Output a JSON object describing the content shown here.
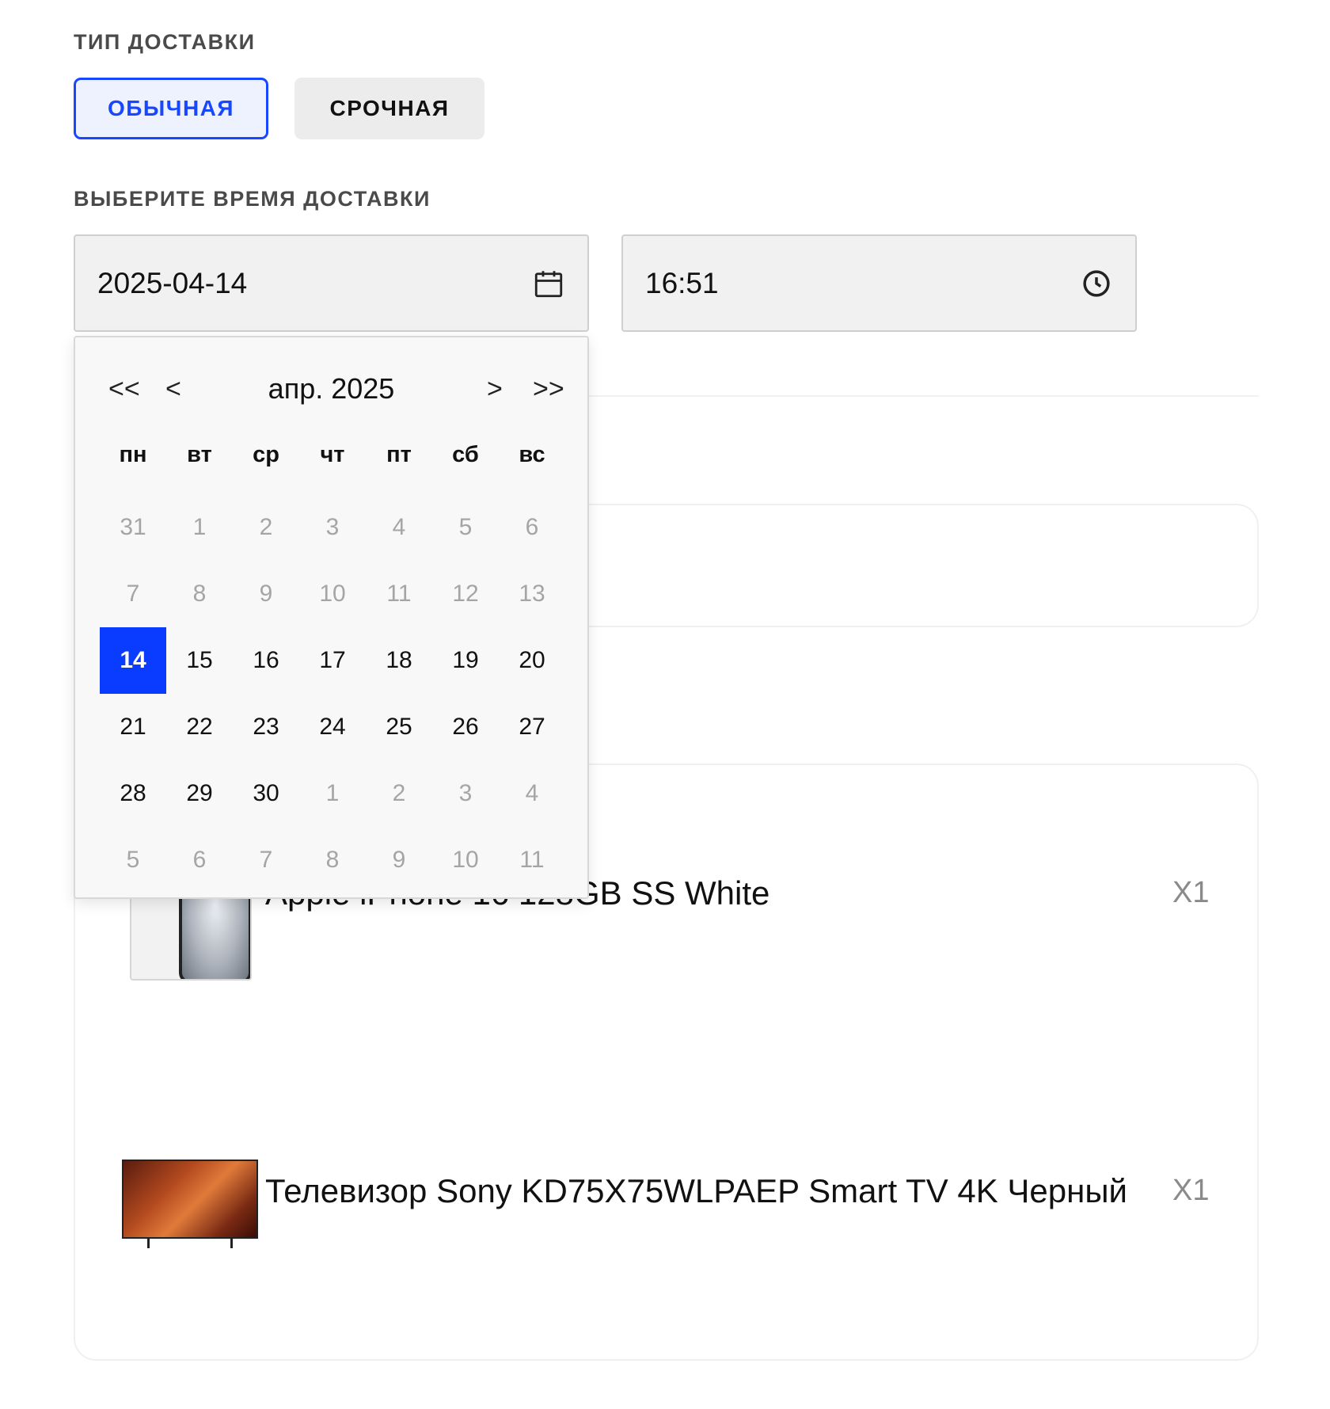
{
  "delivery_type": {
    "label": "ТИП ДОСТАВКИ",
    "options": [
      "ОБЫЧНАЯ",
      "СРОЧНАЯ"
    ],
    "selected": "ОБЫЧНАЯ"
  },
  "delivery_time": {
    "label": "ВЫБЕРИТЕ ВРЕМЯ ДОСТАВКИ",
    "date_value": "2025-04-14",
    "time_value": "16:51",
    "date_icon": "calendar-icon",
    "time_icon": "clock-icon"
  },
  "calendar": {
    "prev_year": "<<",
    "prev_month": "<",
    "month_year": "апр.  2025",
    "next_month": ">",
    "next_year": ">>",
    "weekdays": [
      "пн",
      "вт",
      "ср",
      "чт",
      "пт",
      "сб",
      "вс"
    ],
    "weeks": [
      [
        "31",
        "1",
        "2",
        "3",
        "4",
        "5",
        "6"
      ],
      [
        "7",
        "8",
        "9",
        "10",
        "11",
        "12",
        "13"
      ],
      [
        "14",
        "15",
        "16",
        "17",
        "18",
        "19",
        "20"
      ],
      [
        "21",
        "22",
        "23",
        "24",
        "25",
        "26",
        "27"
      ],
      [
        "28",
        "29",
        "30",
        "1",
        "2",
        "3",
        "4"
      ],
      [
        "5",
        "6",
        "7",
        "8",
        "9",
        "10",
        "11"
      ]
    ],
    "muted_rows": [
      0,
      1,
      5
    ],
    "muted_cells": [
      [
        4,
        3
      ],
      [
        4,
        4
      ],
      [
        4,
        5
      ],
      [
        4,
        6
      ]
    ],
    "selected_day": "14",
    "selected_color": "#0a3cff"
  },
  "items": [
    {
      "title": "Apple iPhone 16 128GB SS White",
      "qty": "X1",
      "thumb": "phone-image"
    },
    {
      "title": "Телевизор Sony KD75X75WLPAEP Smart TV 4K Черный",
      "qty": "X1",
      "thumb": "tv-image"
    }
  ],
  "colors": {
    "accent": "#1747ff",
    "selected": "#0a3cff"
  }
}
